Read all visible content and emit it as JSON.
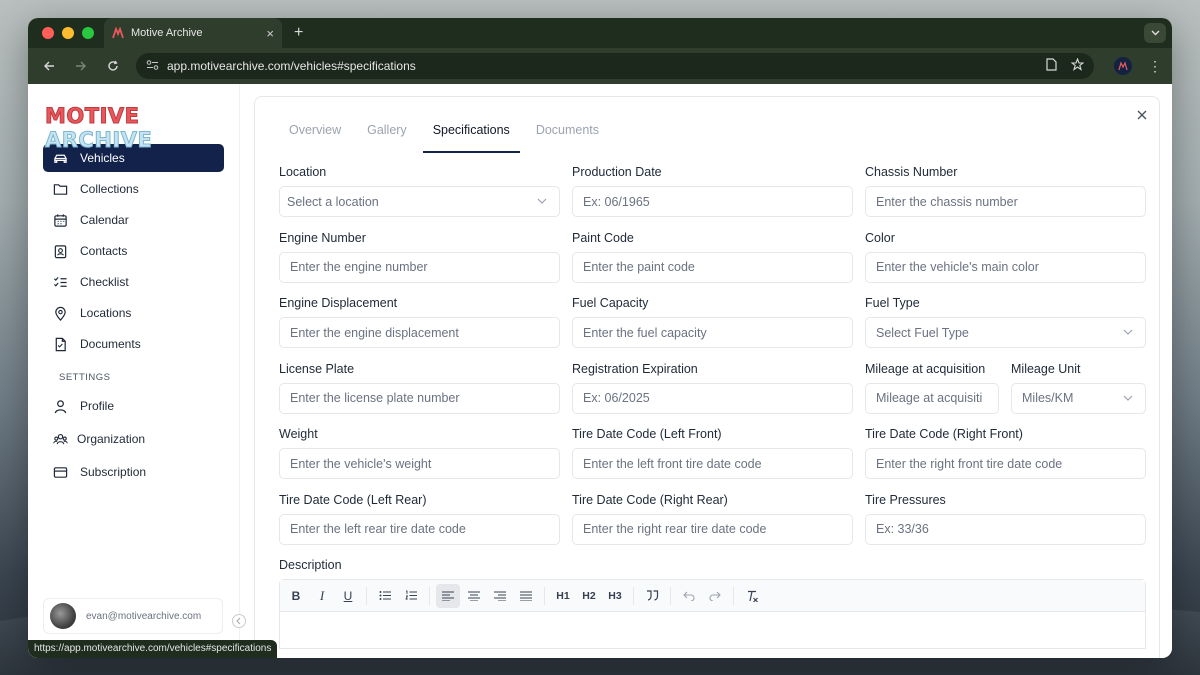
{
  "browser": {
    "tab_title": "Motive Archive",
    "tab_close": "×",
    "new_tab": "+",
    "url": "app.motivearchive.com/vehicles#specifications",
    "status_url": "https://app.motivearchive.com/vehicles#specifications"
  },
  "app": {
    "logo_part1": "MOTIVE",
    "logo_part2": "ARCHIVE",
    "nav": [
      {
        "label": "Vehicles",
        "icon": "car-icon",
        "active": true
      },
      {
        "label": "Collections",
        "icon": "folder-icon"
      },
      {
        "label": "Calendar",
        "icon": "calendar-icon"
      },
      {
        "label": "Contacts",
        "icon": "contact-icon"
      },
      {
        "label": "Checklist",
        "icon": "checklist-icon"
      },
      {
        "label": "Locations",
        "icon": "map-pin-icon"
      },
      {
        "label": "Documents",
        "icon": "document-icon"
      }
    ],
    "settings_heading": "SETTINGS",
    "settings_nav": [
      {
        "label": "Profile",
        "icon": "user-icon"
      },
      {
        "label": "Organization",
        "icon": "users-icon"
      },
      {
        "label": "Subscription",
        "icon": "credit-card-icon"
      }
    ],
    "user_email": "evan@motivearchive.com"
  },
  "panel": {
    "tabs": [
      "Overview",
      "Gallery",
      "Specifications",
      "Documents"
    ],
    "active_tab": "Specifications",
    "fields": {
      "location": {
        "label": "Location",
        "placeholder": "Select a location"
      },
      "production_date": {
        "label": "Production Date",
        "placeholder": "Ex: 06/1965"
      },
      "chassis_number": {
        "label": "Chassis Number",
        "placeholder": "Enter the chassis number"
      },
      "engine_number": {
        "label": "Engine Number",
        "placeholder": "Enter the engine number"
      },
      "paint_code": {
        "label": "Paint Code",
        "placeholder": "Enter the paint code"
      },
      "color": {
        "label": "Color",
        "placeholder": "Enter the vehicle's main color"
      },
      "engine_displacement": {
        "label": "Engine Displacement",
        "placeholder": "Enter the engine displacement"
      },
      "fuel_capacity": {
        "label": "Fuel Capacity",
        "placeholder": "Enter the fuel capacity"
      },
      "fuel_type": {
        "label": "Fuel Type",
        "placeholder": "Select Fuel Type"
      },
      "license_plate": {
        "label": "License Plate",
        "placeholder": "Enter the license plate number"
      },
      "registration_expiration": {
        "label": "Registration Expiration",
        "placeholder": "Ex: 06/2025"
      },
      "mileage_acquisition": {
        "label": "Mileage at acquisition",
        "placeholder": "Mileage at acquisiti"
      },
      "mileage_unit": {
        "label": "Mileage Unit",
        "placeholder": "Miles/KM"
      },
      "weight": {
        "label": "Weight",
        "placeholder": "Enter the vehicle's weight"
      },
      "tire_left_front": {
        "label": "Tire Date Code (Left Front)",
        "placeholder": "Enter the left front tire date code"
      },
      "tire_right_front": {
        "label": "Tire Date Code (Right Front)",
        "placeholder": "Enter the right front tire date code"
      },
      "tire_left_rear": {
        "label": "Tire Date Code (Left Rear)",
        "placeholder": "Enter the left rear tire date code"
      },
      "tire_right_rear": {
        "label": "Tire Date Code (Right Rear)",
        "placeholder": "Enter the right rear tire date code"
      },
      "tire_pressures": {
        "label": "Tire Pressures",
        "placeholder": "Ex: 33/36"
      }
    },
    "description_label": "Description",
    "editor_toolbar": {
      "bold": "B",
      "italic": "I",
      "underline": "U",
      "h1": "H1",
      "h2": "H2",
      "h3": "H3"
    }
  },
  "colors": {
    "accent": "#13224a",
    "browser_chrome": "#2f3d2c"
  }
}
